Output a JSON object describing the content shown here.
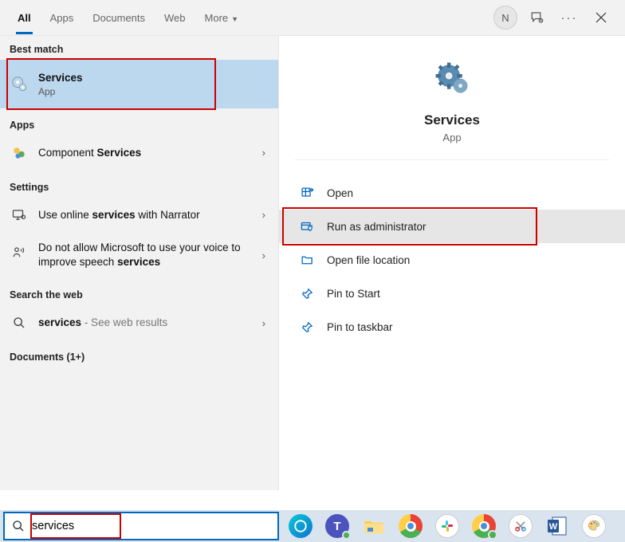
{
  "tabs": {
    "items": [
      {
        "label": "All",
        "active": true
      },
      {
        "label": "Apps",
        "active": false
      },
      {
        "label": "Documents",
        "active": false
      },
      {
        "label": "Web",
        "active": false
      },
      {
        "label": "More",
        "active": false,
        "dropdown": true
      }
    ]
  },
  "header": {
    "avatar_initial": "N"
  },
  "left": {
    "best_match_label": "Best match",
    "best_match": {
      "title": "Services",
      "subtitle": "App"
    },
    "apps_label": "Apps",
    "apps_item": {
      "prefix": "Component ",
      "bold": "Services"
    },
    "settings_label": "Settings",
    "settings_items": [
      {
        "prefix": "Use online ",
        "bold": "services",
        "suffix": " with Narrator"
      },
      {
        "prefix": "Do not allow Microsoft to use your voice to improve speech ",
        "bold": "services",
        "suffix": ""
      }
    ],
    "web_label": "Search the web",
    "web_item": {
      "bold": "services",
      "suffix": " - See web results"
    },
    "documents_label": "Documents (1+)"
  },
  "right": {
    "title": "Services",
    "subtitle": "App",
    "actions": [
      {
        "label": "Open",
        "icon": "open",
        "selected": false
      },
      {
        "label": "Run as administrator",
        "icon": "admin",
        "selected": true
      },
      {
        "label": "Open file location",
        "icon": "folder",
        "selected": false
      },
      {
        "label": "Pin to Start",
        "icon": "pin",
        "selected": false
      },
      {
        "label": "Pin to taskbar",
        "icon": "pin",
        "selected": false
      }
    ]
  },
  "taskbar": {
    "search_value": "services"
  }
}
